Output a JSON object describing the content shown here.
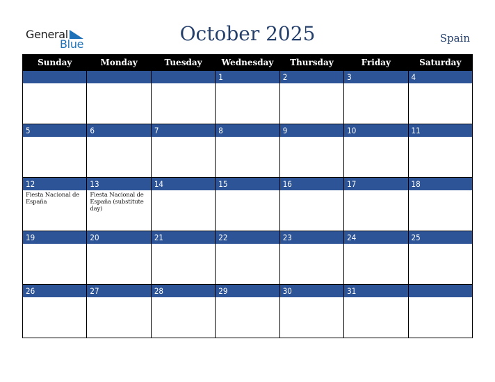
{
  "logo": {
    "line1": "General",
    "line2": "Blue",
    "accent_color": "#1f72b8"
  },
  "header": {
    "title": "October 2025",
    "country": "Spain"
  },
  "colors": {
    "header_bg": "#000000",
    "day_bar": "#2d5496",
    "title_text": "#253f6b"
  },
  "weekdays": [
    "Sunday",
    "Monday",
    "Tuesday",
    "Wednesday",
    "Thursday",
    "Friday",
    "Saturday"
  ],
  "weeks": [
    [
      {
        "day": "",
        "note": ""
      },
      {
        "day": "",
        "note": ""
      },
      {
        "day": "",
        "note": ""
      },
      {
        "day": "1",
        "note": ""
      },
      {
        "day": "2",
        "note": ""
      },
      {
        "day": "3",
        "note": ""
      },
      {
        "day": "4",
        "note": ""
      }
    ],
    [
      {
        "day": "5",
        "note": ""
      },
      {
        "day": "6",
        "note": ""
      },
      {
        "day": "7",
        "note": ""
      },
      {
        "day": "8",
        "note": ""
      },
      {
        "day": "9",
        "note": ""
      },
      {
        "day": "10",
        "note": ""
      },
      {
        "day": "11",
        "note": ""
      }
    ],
    [
      {
        "day": "12",
        "note": "Fiesta Nacional de España"
      },
      {
        "day": "13",
        "note": "Fiesta Nacional de España (substitute day)"
      },
      {
        "day": "14",
        "note": ""
      },
      {
        "day": "15",
        "note": ""
      },
      {
        "day": "16",
        "note": ""
      },
      {
        "day": "17",
        "note": ""
      },
      {
        "day": "18",
        "note": ""
      }
    ],
    [
      {
        "day": "19",
        "note": ""
      },
      {
        "day": "20",
        "note": ""
      },
      {
        "day": "21",
        "note": ""
      },
      {
        "day": "22",
        "note": ""
      },
      {
        "day": "23",
        "note": ""
      },
      {
        "day": "24",
        "note": ""
      },
      {
        "day": "25",
        "note": ""
      }
    ],
    [
      {
        "day": "26",
        "note": ""
      },
      {
        "day": "27",
        "note": ""
      },
      {
        "day": "28",
        "note": ""
      },
      {
        "day": "29",
        "note": ""
      },
      {
        "day": "30",
        "note": ""
      },
      {
        "day": "31",
        "note": ""
      },
      {
        "day": "",
        "note": ""
      }
    ]
  ]
}
